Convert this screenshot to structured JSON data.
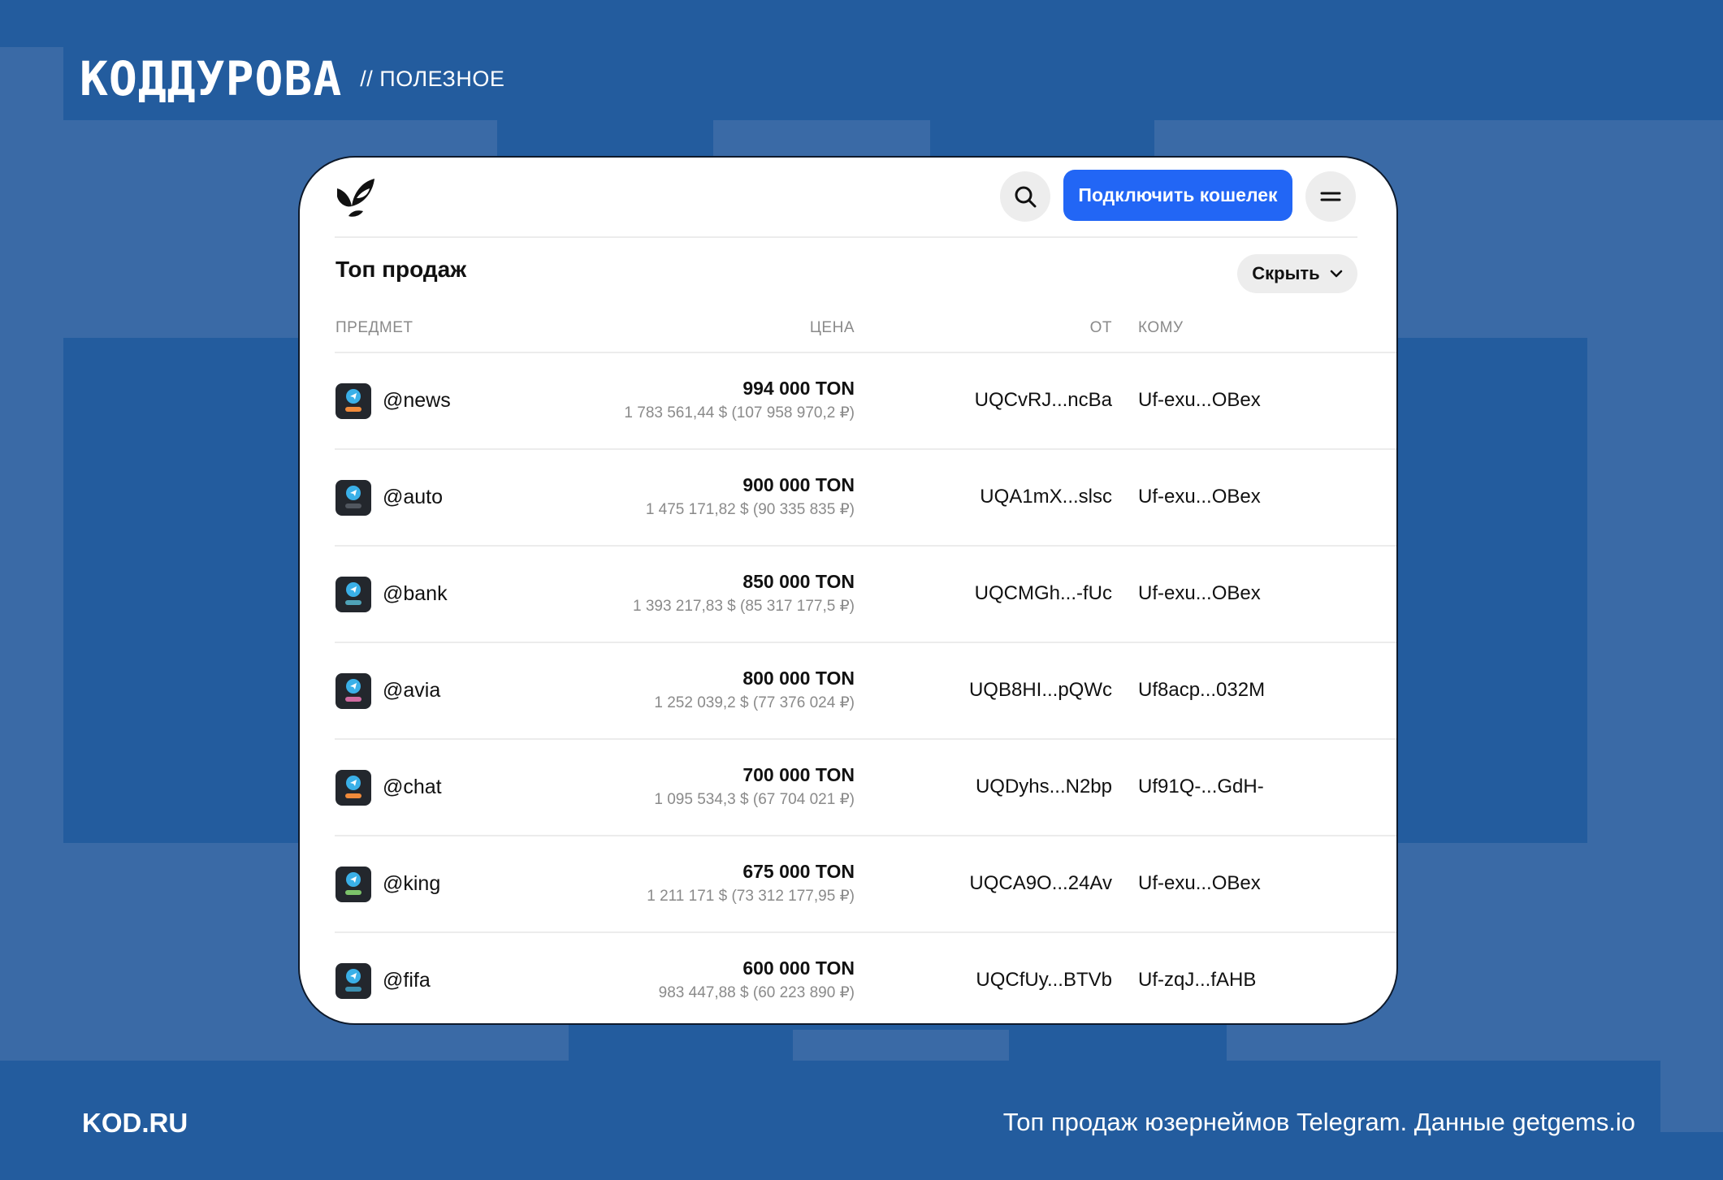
{
  "brand": {
    "logo_text": "КОДДУРОВА",
    "section": "// ПОЛЕЗНОЕ"
  },
  "footer": {
    "site": "KOD.RU",
    "caption": "Топ продаж юзернеймов Telegram. Данные getgems.io"
  },
  "app": {
    "logo_icon": "getgems-logo-icon",
    "search_icon": "search-icon",
    "connect_label": "Подключить кошелек",
    "menu_icon": "menu-icon"
  },
  "section": {
    "title": "Топ продаж",
    "hide_label": "Скрыть"
  },
  "columns": {
    "item": "ПРЕДМЕТ",
    "price": "ЦЕНА",
    "from": "ОТ",
    "to": "КОМУ"
  },
  "colors": {
    "background": "#235c9e",
    "accent": "#2266f5"
  },
  "rows": [
    {
      "name": "@news",
      "price": "994 000 TON",
      "fiat": "1 783 561,44 $ (107 958 970,2 ₽)",
      "from": "UQCvRJ...ncBa",
      "to": "Uf-exu...OBex",
      "badge_color": "#f08a3a"
    },
    {
      "name": "@auto",
      "price": "900 000 TON",
      "fiat": "1 475 171,82 $ (90 335 835 ₽)",
      "from": "UQA1mX...slsc",
      "to": "Uf-exu...OBex",
      "badge_color": "#50565e"
    },
    {
      "name": "@bank",
      "price": "850 000 TON",
      "fiat": "1 393 217,83 $ (85 317 177,5 ₽)",
      "from": "UQCMGh...-fUc",
      "to": "Uf-exu...OBex",
      "badge_color": "#4fa3b8"
    },
    {
      "name": "@avia",
      "price": "800 000 TON",
      "fiat": "1 252 039,2 $ (77 376 024 ₽)",
      "from": "UQB8HI...pQWc",
      "to": "Uf8acp...032M",
      "badge_color": "#d06aa0"
    },
    {
      "name": "@chat",
      "price": "700 000 TON",
      "fiat": "1 095 534,3 $ (67 704 021 ₽)",
      "from": "UQDyhs...N2bp",
      "to": "Uf91Q-...GdH-",
      "badge_color": "#f08a3a"
    },
    {
      "name": "@king",
      "price": "675 000 TON",
      "fiat": "1 211 171 $ (73 312 177,95 ₽)",
      "from": "UQCA9O...24Av",
      "to": "Uf-exu...OBex",
      "badge_color": "#7cc36a"
    },
    {
      "name": "@fifa",
      "price": "600 000 TON",
      "fiat": "983 447,88 $ (60 223 890 ₽)",
      "from": "UQCfUy...BTVb",
      "to": "Uf-zqJ...fAHB",
      "badge_color": "#3b8fb0"
    }
  ]
}
